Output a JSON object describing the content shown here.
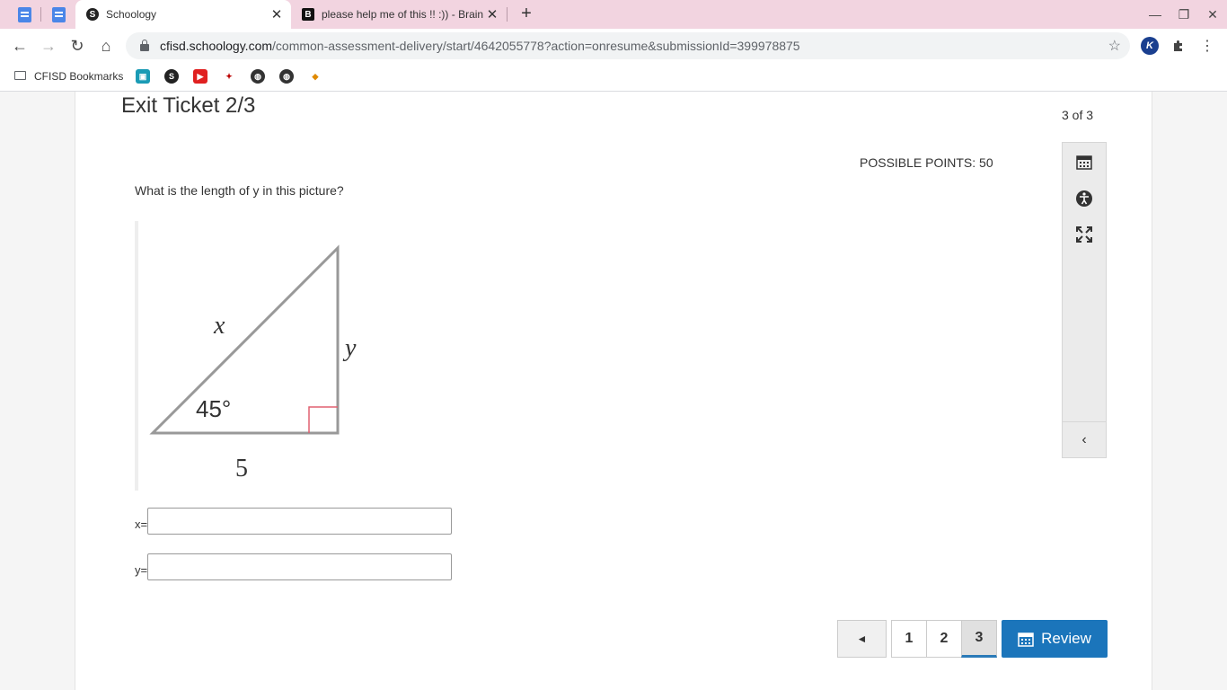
{
  "browser": {
    "tabs": [
      {
        "title": "Schoology",
        "favicon": "S"
      },
      {
        "title": "please help me of this !! :)) - Brainly",
        "favicon": "B"
      }
    ],
    "url_host": "cfisd.schoology.com",
    "url_path": "/common-assessment-delivery/start/4642055778?action=onresume&submissionId=399978875",
    "extension_k": "K",
    "bookmarks_folder": "CFISD Bookmarks"
  },
  "assessment": {
    "title": "Exit Ticket 2/3",
    "counter": "3 of 3",
    "points": "POSSIBLE POINTS: 50",
    "question": "What is the length of y in this picture?",
    "figure": {
      "label_x": "x",
      "label_y": "y",
      "angle": "45°",
      "base": "5"
    },
    "answers": [
      {
        "label": "x=",
        "value": ""
      },
      {
        "label": "y=",
        "value": ""
      }
    ]
  },
  "pagination": {
    "prev": "◄",
    "pages": [
      "1",
      "2",
      "3"
    ],
    "current": "3",
    "review_label": "Review"
  },
  "colors": {
    "accent": "#1b75bb",
    "tabstrip": "#f2d4e0"
  }
}
